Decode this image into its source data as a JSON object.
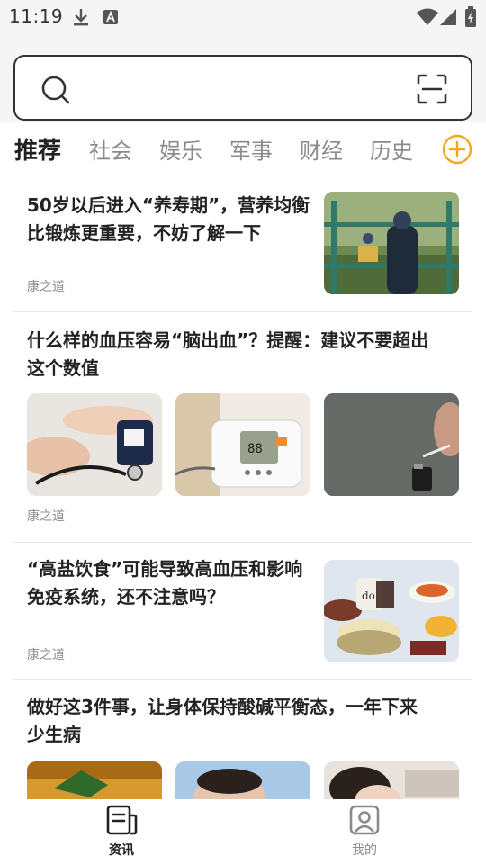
{
  "status_bar": {
    "time": "11:19",
    "icons": [
      "download-icon",
      "a-badge-icon",
      "wifi-icon",
      "signal-icon",
      "battery-icon"
    ]
  },
  "search": {
    "placeholder": "",
    "icons": [
      "search-icon",
      "scan-icon"
    ]
  },
  "tabs": [
    {
      "label": "推荐",
      "active": true
    },
    {
      "label": "社会",
      "active": false
    },
    {
      "label": "娱乐",
      "active": false
    },
    {
      "label": "军事",
      "active": false
    },
    {
      "label": "财经",
      "active": false
    },
    {
      "label": "历史",
      "active": false
    }
  ],
  "articles": [
    {
      "title_line1": "50岁以后进入“养寿期”，营养均衡",
      "title_line2": "比锻炼更重要，不妨了解一下",
      "source": "康之道"
    },
    {
      "title_line1": "什么样的血压容易“脑出血”？提醒：建议不要超出",
      "title_line2": "这个数值",
      "source": "康之道"
    },
    {
      "title_line1": "“高盐饮食”可能导致高血压和影响",
      "title_line2": "免疫系统，还不注意吗？",
      "source": "康之道"
    },
    {
      "title_line1": "做好这3件事，让身体保持酸碱平衡态，一年下来",
      "title_line2": "少生病",
      "source": ""
    }
  ],
  "bottom_nav": {
    "items": [
      {
        "label": "资讯",
        "icon": "news-icon",
        "active": true
      },
      {
        "label": "我的",
        "icon": "profile-icon",
        "active": false
      }
    ]
  },
  "colors": {
    "accent": "#f5a623",
    "text": "#222222",
    "muted": "#8a8a8a",
    "divider": "#e6e6e6",
    "header_bg": "#f5f5f5"
  }
}
